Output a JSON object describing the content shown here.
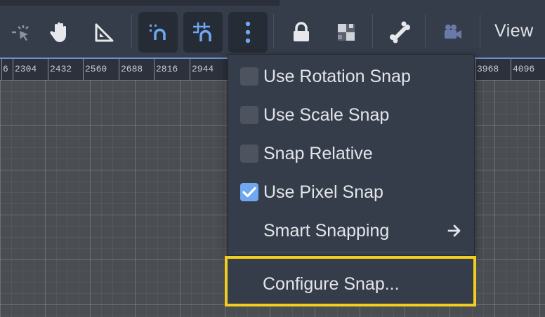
{
  "toolbar": {
    "tools": [
      {
        "icon": "list-select-icon",
        "active": false
      },
      {
        "icon": "pan-hand-icon",
        "active": false
      },
      {
        "icon": "ruler-icon",
        "active": false
      },
      {
        "icon": "smart-snap-icon",
        "active": true
      },
      {
        "icon": "grid-snap-icon",
        "active": true
      },
      {
        "icon": "more-options-icon",
        "active": true
      },
      {
        "icon": "lock-icon",
        "active": false
      },
      {
        "icon": "group-icon",
        "active": false
      },
      {
        "icon": "bone-icon",
        "active": false
      },
      {
        "icon": "camera-icon",
        "active": false
      }
    ],
    "view_label": "View"
  },
  "ruler": {
    "ticks_left": [
      "6",
      "2304",
      "2432",
      "2560",
      "2688",
      "2816",
      "2944"
    ],
    "ticks_right": [
      "3968",
      "4096"
    ]
  },
  "snap_menu": {
    "items": [
      {
        "label": "Use Rotation Snap",
        "checked": false
      },
      {
        "label": "Use Scale Snap",
        "checked": false
      },
      {
        "label": "Snap Relative",
        "checked": false
      },
      {
        "label": "Use Pixel Snap",
        "checked": true
      },
      {
        "label": "Smart Snapping",
        "submenu": true
      }
    ],
    "configure_label": "Configure Snap...",
    "highlight_color": "#f2cd1f",
    "check_color": "#6fa8f0"
  }
}
